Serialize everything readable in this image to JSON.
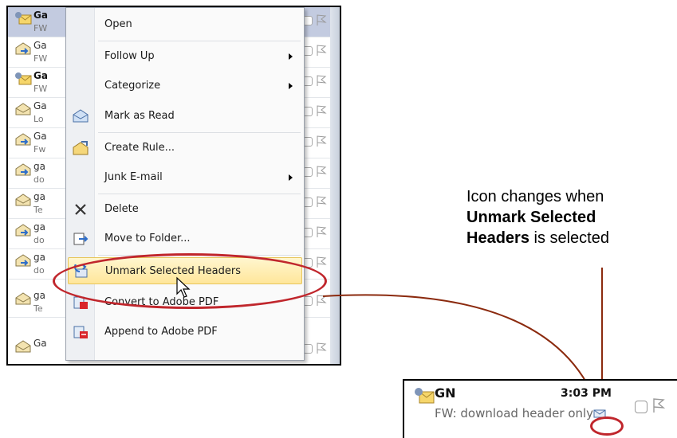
{
  "messages": [
    {
      "sender": "Ga",
      "subject": "FW",
      "unread": true,
      "selected": true
    },
    {
      "sender": "Ga",
      "subject": "FW",
      "unread": false,
      "selected": false
    },
    {
      "sender": "Ga",
      "subject": "FW",
      "unread": true,
      "selected": false
    },
    {
      "sender": "Ga",
      "subject": "Lo",
      "unread": false,
      "selected": false
    },
    {
      "sender": "Ga",
      "subject": "Fw",
      "unread": false,
      "selected": false
    },
    {
      "sender": "ga",
      "subject": "do",
      "unread": false,
      "selected": false
    },
    {
      "sender": "ga",
      "subject": "Te",
      "unread": false,
      "selected": false
    },
    {
      "sender": "Ga",
      "subject": "",
      "unread": false,
      "selected": false
    }
  ],
  "context_menu": {
    "items": [
      {
        "label": "Open",
        "icon": "none",
        "submenu": false
      },
      {
        "label": "Follow Up",
        "icon": "none",
        "submenu": true
      },
      {
        "label": "Categorize",
        "icon": "none",
        "submenu": true
      },
      {
        "label": "Mark as Read",
        "icon": "envelope-open-icon",
        "submenu": false
      },
      {
        "label": "Create Rule...",
        "icon": "create-rule-icon",
        "submenu": false
      },
      {
        "label": "Junk E-mail",
        "icon": "none",
        "submenu": true
      },
      {
        "label": "Delete",
        "icon": "delete-x-icon",
        "submenu": false
      },
      {
        "label": "Move to Folder...",
        "icon": "move-folder-icon",
        "submenu": false
      },
      {
        "label": "Unmark Selected Headers",
        "icon": "unmark-headers-icon",
        "submenu": false,
        "highlighted": true
      },
      {
        "label": "Convert to Adobe PDF",
        "icon": "adobe-pdf-icon",
        "submenu": false
      },
      {
        "label": "Append to Adobe PDF",
        "icon": "adobe-pdf-append-icon",
        "submenu": false
      }
    ]
  },
  "callout": {
    "line1": "Icon changes when",
    "bold1": "Unmark Selected",
    "bold2": "Headers",
    "tail": " is selected"
  },
  "zoom_row": {
    "sender": "GN",
    "time": "3:03 PM",
    "subject": "FW: download header only"
  },
  "colors": {
    "highlight_ring": "#c0262c",
    "selection": "#c3cbe0",
    "arrow": "#8b2a0e"
  }
}
